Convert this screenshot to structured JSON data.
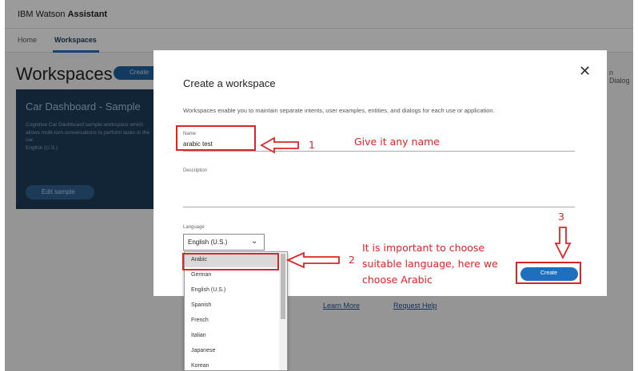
{
  "app": {
    "brand_prefix": "IBM Watson",
    "brand_bold": "Assistant",
    "tabs": [
      "Home",
      "Workspaces"
    ],
    "page_title": "Workspaces",
    "create_label": "Create",
    "right_partial": "n Dialog",
    "learn_more": "Learn More",
    "request_help": "Request Help"
  },
  "card": {
    "title": "Car Dashboard - Sample",
    "description": "Cognitive Car Dashboard sample workspace which allows multi-turn conversations to perform tasks in the car.",
    "language": "English (U.S.)",
    "button": "Edit sample"
  },
  "modal": {
    "title": "Create a workspace",
    "close": "✕",
    "description": "Workspaces enable you to maintain separate intents, user examples, entities, and dialogs for each use or application.",
    "name_label": "Name",
    "name_value": "arabic test",
    "description_label": "Description",
    "language_label": "Language",
    "language_value": "English (U.S.)",
    "create_button": "Create"
  },
  "dropdown": {
    "selected": "Arabic",
    "options": [
      "Arabic",
      "German",
      "English (U.S.)",
      "Spanish",
      "French",
      "Italian",
      "Japanese",
      "Korean"
    ]
  },
  "annotations": {
    "step1_num": "1",
    "step1_text": "Give it any name",
    "step2_num": "2",
    "step2_text_line1": "It is important to choose",
    "step2_text_line2": "suitable language, here we",
    "step2_text_line3": "choose Arabic",
    "step3_num": "3",
    "color": "#e02424"
  }
}
